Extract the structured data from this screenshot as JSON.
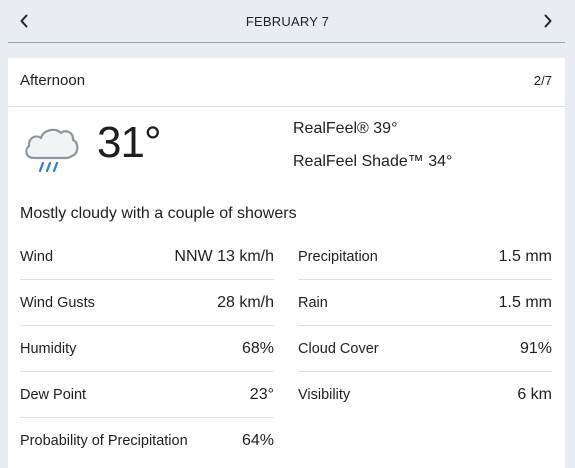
{
  "date_bar": {
    "title": "FEBRUARY 7",
    "prev_icon": "chevron-left-icon",
    "next_icon": "chevron-right-icon"
  },
  "card": {
    "period": "Afternoon",
    "pager": "2/7",
    "icon": "cloud-rain-icon",
    "temperature": "31°",
    "realfeel": "RealFeel® 39°",
    "realfeel_shade": "RealFeel Shade™ 34°",
    "phrase": "Mostly cloudy with a couple of showers"
  },
  "details": {
    "left": [
      {
        "label": "Wind",
        "value": "NNW 13 km/h"
      },
      {
        "label": "Wind Gusts",
        "value": "28 km/h"
      },
      {
        "label": "Humidity",
        "value": "68%"
      },
      {
        "label": "Dew Point",
        "value": "23°"
      },
      {
        "label": "Probability of Precipitation",
        "value": "64%"
      }
    ],
    "right": [
      {
        "label": "Precipitation",
        "value": "1.5 mm"
      },
      {
        "label": "Rain",
        "value": "1.5 mm"
      },
      {
        "label": "Cloud Cover",
        "value": "91%"
      },
      {
        "label": "Visibility",
        "value": "6 km"
      }
    ]
  }
}
